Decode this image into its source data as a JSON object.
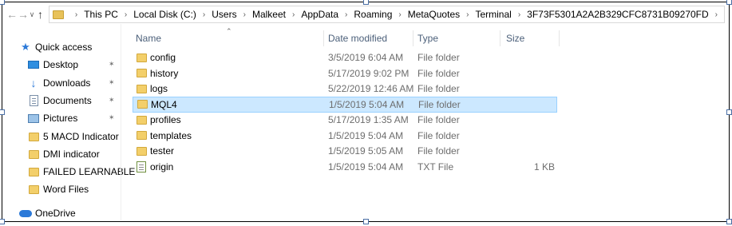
{
  "nav": {
    "back_icon": "arrow-left-icon",
    "forward_icon": "arrow-right-icon",
    "recent_icon": "chevron-down-icon",
    "up_icon": "arrow-up-icon"
  },
  "breadcrumb": [
    "This PC",
    "Local Disk (C:)",
    "Users",
    "Malkeet",
    "AppData",
    "Roaming",
    "MetaQuotes",
    "Terminal",
    "3F73F5301A2A2B329CFC8731B09270FD"
  ],
  "sidebar": {
    "items": [
      {
        "label": "Quick access",
        "icon": "star-icon",
        "pinned": false
      },
      {
        "label": "Desktop",
        "icon": "desktop-icon",
        "pinned": true
      },
      {
        "label": "Downloads",
        "icon": "download-icon",
        "pinned": true
      },
      {
        "label": "Documents",
        "icon": "documents-icon",
        "pinned": true
      },
      {
        "label": "Pictures",
        "icon": "pictures-icon",
        "pinned": true
      },
      {
        "label": "5 MACD Indicator",
        "icon": "folder-icon",
        "pinned": false
      },
      {
        "label": "DMI indicator",
        "icon": "folder-icon",
        "pinned": false
      },
      {
        "label": "FAILED LEARNABLE",
        "icon": "folder-icon",
        "pinned": false
      },
      {
        "label": "Word Files",
        "icon": "folder-icon",
        "pinned": false
      },
      {
        "label": "OneDrive",
        "icon": "onedrive-icon",
        "pinned": false
      }
    ]
  },
  "columns": {
    "name": "Name",
    "date": "Date modified",
    "type": "Type",
    "size": "Size"
  },
  "files": [
    {
      "name": "config",
      "date": "3/5/2019 6:04 AM",
      "type": "File folder",
      "size": "",
      "icon": "folder-icon",
      "selected": false
    },
    {
      "name": "history",
      "date": "5/17/2019 9:02 PM",
      "type": "File folder",
      "size": "",
      "icon": "folder-icon",
      "selected": false
    },
    {
      "name": "logs",
      "date": "5/22/2019 12:46 AM",
      "type": "File folder",
      "size": "",
      "icon": "folder-icon",
      "selected": false
    },
    {
      "name": "MQL4",
      "date": "1/5/2019 5:04 AM",
      "type": "File folder",
      "size": "",
      "icon": "folder-icon",
      "selected": true
    },
    {
      "name": "profiles",
      "date": "5/17/2019 1:35 AM",
      "type": "File folder",
      "size": "",
      "icon": "folder-icon",
      "selected": false
    },
    {
      "name": "templates",
      "date": "1/5/2019 5:04 AM",
      "type": "File folder",
      "size": "",
      "icon": "folder-icon",
      "selected": false
    },
    {
      "name": "tester",
      "date": "1/5/2019 5:05 AM",
      "type": "File folder",
      "size": "",
      "icon": "folder-icon",
      "selected": false
    },
    {
      "name": "origin",
      "date": "1/5/2019 5:04 AM",
      "type": "TXT File",
      "size": "1 KB",
      "icon": "text-file-icon",
      "selected": false
    }
  ],
  "colors": {
    "selection_bg": "#cce8ff",
    "selection_border": "#99d1ff",
    "folder": "#f3cf6a",
    "accent": "#2b79d8"
  }
}
